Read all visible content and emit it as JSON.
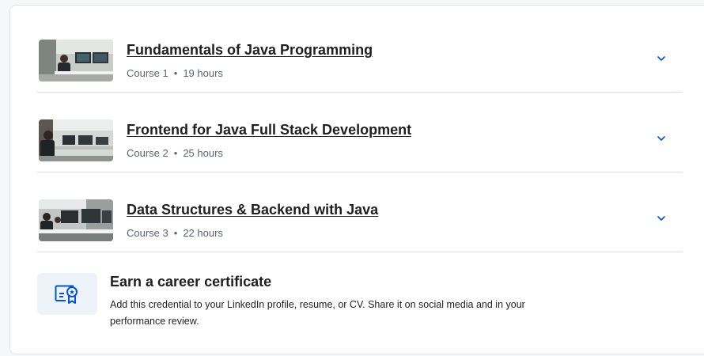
{
  "courses": [
    {
      "title": "Fundamentals of Java Programming",
      "course_label": "Course 1",
      "duration": "19 hours",
      "icon": "chevron-down-icon"
    },
    {
      "title": "Frontend for Java Full Stack Development",
      "course_label": "Course 2",
      "duration": "25 hours",
      "icon": "chevron-down-icon"
    },
    {
      "title": "Data Structures & Backend with Java",
      "course_label": "Course 3",
      "duration": "22 hours",
      "icon": "chevron-down-icon"
    }
  ],
  "separator": "•",
  "certificate": {
    "title": "Earn a career certificate",
    "description": "Add this credential to your LinkedIn profile, resume, or CV. Share it on social media and in your performance review.",
    "icon": "certificate-icon"
  },
  "colors": {
    "accent": "#0056d2",
    "text": "#1f1f1f",
    "muted": "#5b6470",
    "divider": "#d7dde3",
    "icon_bg": "#eef3fa"
  }
}
